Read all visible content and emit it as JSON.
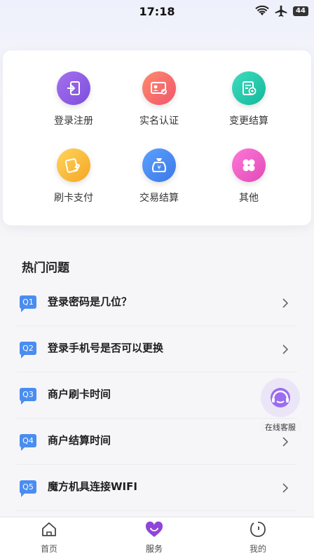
{
  "status": {
    "time": "17:18",
    "battery": "44",
    "icons": [
      "wifi-icon",
      "airplane-icon",
      "battery-icon"
    ]
  },
  "grid": {
    "items": [
      {
        "label": "登录注册",
        "icon": "login-icon",
        "color": "#8d5ce6"
      },
      {
        "label": "实名认证",
        "icon": "id-card-icon",
        "color": "#f36d6d"
      },
      {
        "label": "变更结算",
        "icon": "settlement-change-icon",
        "color": "#23c8a8"
      },
      {
        "label": "刷卡支付",
        "icon": "card-pay-icon",
        "color": "#f6b73c"
      },
      {
        "label": "交易结算",
        "icon": "money-bag-icon",
        "color": "#4a8df0"
      },
      {
        "label": "其他",
        "icon": "clover-icon",
        "color": "#ec5fc4"
      }
    ]
  },
  "faq": {
    "title": "热门问题",
    "items": [
      {
        "badge": "Q1",
        "text": "登录密码是几位？"
      },
      {
        "badge": "Q2",
        "text": "登录手机号是否可以更换"
      },
      {
        "badge": "Q3",
        "text": "商户刷卡时间"
      },
      {
        "badge": "Q4",
        "text": "商户结算时间"
      },
      {
        "badge": "Q5",
        "text": "魔方机具连接WIFI"
      }
    ]
  },
  "customer_service": {
    "label": "在线客服",
    "icon": "headset-icon"
  },
  "tabs": [
    {
      "label": "首页",
      "icon": "home-icon"
    },
    {
      "label": "服务",
      "icon": "heart-icon",
      "active": true
    },
    {
      "label": "我的",
      "icon": "profile-icon"
    }
  ]
}
